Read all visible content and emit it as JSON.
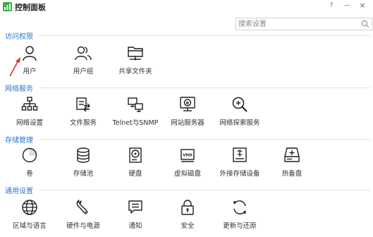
{
  "window": {
    "title": "控制面板",
    "help_label": "?",
    "minimize_label": "—",
    "close_label": "×"
  },
  "search": {
    "placeholder": "搜索设置",
    "value": ""
  },
  "colors": {
    "accent": "#2b78d0",
    "icon": "#1f1f1f",
    "logo": "#3ea84a",
    "arrow": "#e03030"
  },
  "sections": [
    {
      "title": "访问权限",
      "items": [
        {
          "label": "用户",
          "icon": "user-icon"
        },
        {
          "label": "用户组",
          "icon": "user-group-icon"
        },
        {
          "label": "共享文件夹",
          "icon": "shared-folder-icon"
        }
      ]
    },
    {
      "title": "网络服务",
      "items": [
        {
          "label": "网络设置",
          "icon": "network-icon"
        },
        {
          "label": "文件服务",
          "icon": "file-service-icon"
        },
        {
          "label": "Telnet与SNMP",
          "icon": "telnet-icon"
        },
        {
          "label": "网站服务器",
          "icon": "web-server-icon"
        },
        {
          "label": "网络探索服务",
          "icon": "network-discovery-icon"
        }
      ]
    },
    {
      "title": "存储管理",
      "items": [
        {
          "label": "卷",
          "icon": "volume-icon"
        },
        {
          "label": "存储池",
          "icon": "storage-pool-icon"
        },
        {
          "label": "硬盘",
          "icon": "hard-disk-icon"
        },
        {
          "label": "虚拟磁盘",
          "icon": "virtual-disk-icon"
        },
        {
          "label": "外接存储设备",
          "icon": "external-storage-icon"
        },
        {
          "label": "热备盘",
          "icon": "hot-spare-icon"
        }
      ]
    },
    {
      "title": "通用设置",
      "items": [
        {
          "label": "区域与语言",
          "icon": "globe-icon"
        },
        {
          "label": "硬件与电源",
          "icon": "wrench-icon"
        },
        {
          "label": "通知",
          "icon": "notification-icon"
        },
        {
          "label": "安全",
          "icon": "lock-icon"
        },
        {
          "label": "更新与还原",
          "icon": "update-restore-icon"
        }
      ]
    }
  ]
}
